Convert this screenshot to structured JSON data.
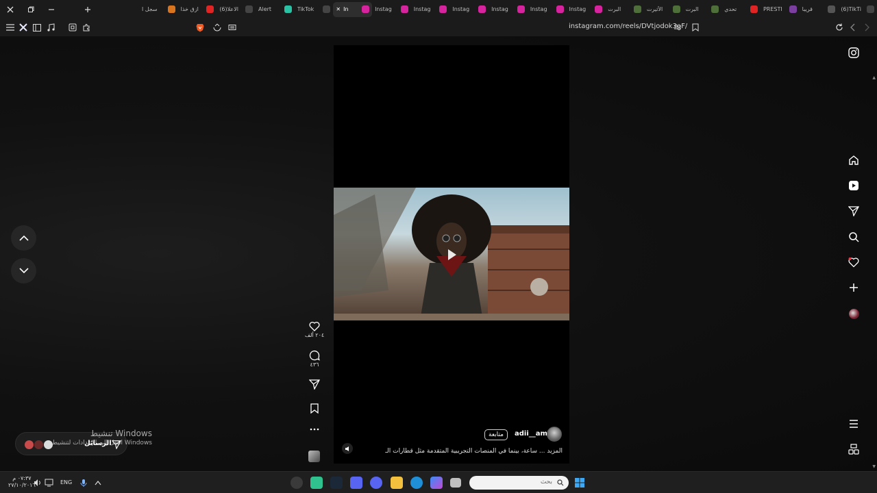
{
  "browser": {
    "tabs": [
      {
        "label": "(6)TikTi",
        "favicon": "tiktok-icon",
        "color": "#444444"
      },
      {
        "label": "قريبا",
        "favicon": "gear-icon",
        "color": "#555555"
      },
      {
        "label": "PRESTI",
        "favicon": "circle-icon",
        "color": "#7b3fa0"
      },
      {
        "label": "تحدي",
        "favicon": "youtube-icon",
        "color": "#e02424"
      },
      {
        "label": "البرت",
        "favicon": "avatar-icon",
        "color": "#4e6e3a"
      },
      {
        "label": "الأثيرت",
        "favicon": "avatar-icon",
        "color": "#4e6e3a"
      },
      {
        "label": "البرت",
        "favicon": "avatar-icon",
        "color": "#4e6e3a"
      },
      {
        "label": "Instag",
        "favicon": "instagram-icon",
        "color": "#d6249f"
      },
      {
        "label": "Instag",
        "favicon": "instagram-icon",
        "color": "#d6249f"
      },
      {
        "label": "Instag",
        "favicon": "instagram-icon",
        "color": "#d6249f"
      },
      {
        "label": "Instag",
        "favicon": "instagram-icon",
        "color": "#d6249f"
      },
      {
        "label": "Instag",
        "favicon": "instagram-icon",
        "color": "#d6249f"
      },
      {
        "label": "Instag",
        "favicon": "instagram-icon",
        "color": "#d6249f"
      },
      {
        "label": "In",
        "favicon": "instagram-icon",
        "color": "#d6249f",
        "active": true
      },
      {
        "label": "TikTok",
        "favicon": "tiktok-icon",
        "color": "#444444"
      },
      {
        "label": "Alert",
        "favicon": "alert-icon",
        "color": "#29c2a5"
      },
      {
        "label": "(6)الاعلا",
        "favicon": "tiktok-icon",
        "color": "#444444"
      },
      {
        "label": "ازق خذا",
        "favicon": "youtube-icon",
        "color": "#e02424"
      },
      {
        "label": "سجل ا",
        "favicon": "flame-icon",
        "color": "#d8741e"
      }
    ],
    "url": "instagram.com/reels/DVtjodok3aF/"
  },
  "reel": {
    "username": "adii__am",
    "follow_label": "متابعة",
    "caption": "المزيد ... ساعة، بينما في المنصات التجريبية المتقدمة مثل قطارات الـ",
    "likes": "٢٠٤ ألف",
    "comments": "٤٣٦"
  },
  "messages": {
    "label": "الرسائل"
  },
  "activation": {
    "title": "تنشيط Windows",
    "subtitle": "انتقل إلى الإعدادات لتنشيط Windows"
  },
  "taskbar": {
    "search_placeholder": "بحث",
    "lang": "ENG",
    "time": "٠٧:٣٧ م",
    "date": "٢٧/١٠/٢٠١٦"
  },
  "colors": {
    "accent": "#d6249f",
    "notification": "#ff3040"
  }
}
